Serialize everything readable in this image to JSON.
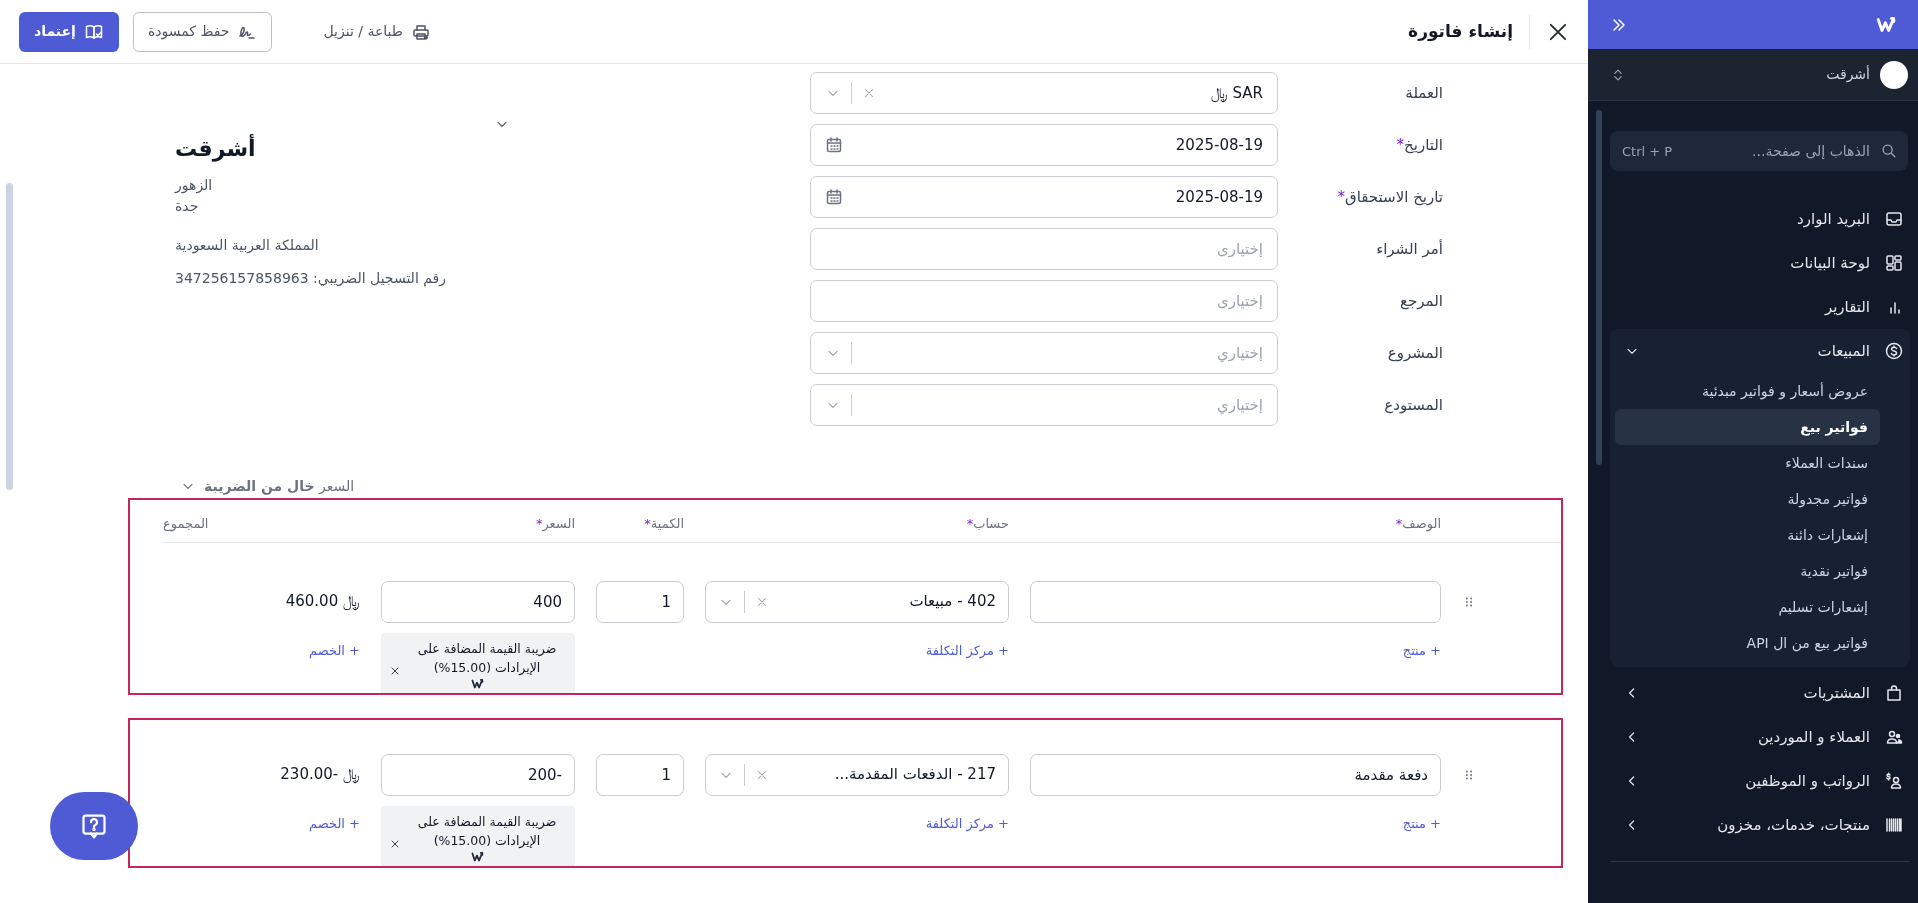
{
  "header": {
    "title": "إنشاء فاتورة",
    "actions": [
      {
        "kind": "link",
        "label": "طباعة / تنزيل"
      },
      {
        "kind": "outline",
        "label": "حفظ كمسودة"
      },
      {
        "kind": "primary",
        "label": "إعتماد"
      }
    ]
  },
  "form": {
    "fields": [
      {
        "kind": "select",
        "label": "العملة",
        "value": "SAR ﷼",
        "clearable": true
      },
      {
        "kind": "date",
        "label": "التاريخ",
        "required_mark": "*",
        "value": "2025-08-19"
      },
      {
        "kind": "date",
        "label": "تاريخ الاستحقاق",
        "required_mark": "*",
        "value": "2025-08-19"
      },
      {
        "kind": "text",
        "label": "أمر الشراء",
        "placeholder": "إختيارى"
      },
      {
        "kind": "text",
        "label": "المرجع",
        "placeholder": "إختيارى"
      },
      {
        "kind": "select",
        "label": "المشروع",
        "placeholder": "إختياري",
        "clearable": false
      },
      {
        "kind": "select",
        "label": "المستودع",
        "placeholder": "إختياري",
        "clearable": false
      }
    ]
  },
  "customer": {
    "name": "أشرقت",
    "address": [
      "الزهور",
      "جدة"
    ],
    "country": "المملكة العربية السعودية",
    "tax_number": "رقم التسجيل الضريبي: 347256157858963"
  },
  "price_mode": "السعر **خال من الضريبة**",
  "line_items": {
    "columns": [
      {
        "label": "الوصف",
        "required_mark": "*"
      },
      {
        "label": "حساب",
        "required_mark": "*"
      },
      {
        "label": "الكمية",
        "required_mark": "*"
      },
      {
        "label": "السعر",
        "required_mark": "*"
      },
      {
        "label": "المجموع"
      }
    ],
    "rows": [
      {
        "account": "402 - مبيعات",
        "quantity": "1",
        "price": "400",
        "total": "﷼ 460.00",
        "product_link": "+ منتج",
        "cost_center_link": "+ مركز التكلفة",
        "tax": "ضريبة القيمة المضافة على الإيرادات (15.00%)",
        "discount_link": "+ الخصم"
      },
      {
        "description": "دفعة مقدمة",
        "account": "217 - الدفعات المقدمة...",
        "quantity": "1",
        "price": "-200",
        "total": "﷼ -230.00",
        "product_link": "+ منتج",
        "cost_center_link": "+ مركز التكلفة",
        "tax": "ضريبة القيمة المضافة على الإيرادات (15.00%)",
        "discount_link": "+ الخصم"
      }
    ]
  },
  "sidebar": {
    "org": {
      "name": "أشرقت"
    },
    "search": {
      "placeholder": "الذهاب إلى صفحة...",
      "shortcut": "Ctrl + P"
    },
    "items": [
      {
        "label": "البريد الوارد"
      },
      {
        "label": "لوحة البيانات"
      },
      {
        "label": "التقارير"
      },
      {
        "label": "المبيعات",
        "expanded": true,
        "children": [
          {
            "label": "عروض أسعار و فواتير مبدئية",
            "selected": false
          },
          {
            "label": "فواتير بيع",
            "selected": true
          },
          {
            "label": "سندات العملاء",
            "selected": false
          },
          {
            "label": "فواتير مجدولة",
            "selected": false
          },
          {
            "label": "إشعارات دائنة",
            "selected": false
          },
          {
            "label": "فواتير نقدية",
            "selected": false
          },
          {
            "label": "إشعارات تسليم",
            "selected": false
          },
          {
            "label": "فواتير بيع من ال API",
            "selected": false
          }
        ]
      },
      {
        "label": "المشتريات",
        "expanded": false
      },
      {
        "label": "العملاء و الموردين",
        "expanded": false
      },
      {
        "label": "الرواتب و الموظفين",
        "expanded": false
      },
      {
        "label": "منتجات، خدمات، مخزون",
        "expanded": false
      }
    ]
  }
}
